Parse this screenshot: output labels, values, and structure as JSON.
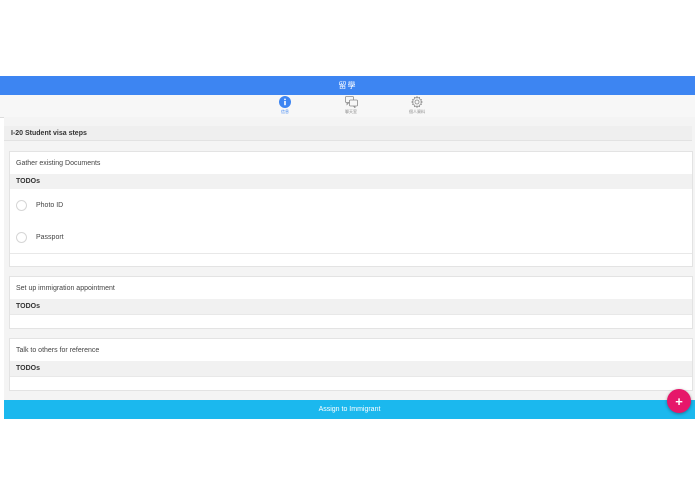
{
  "header": {
    "title": "留學"
  },
  "tabs": [
    {
      "label": "信息",
      "icon": "info-icon",
      "active": true
    },
    {
      "label": "聊天室",
      "icon": "chat-icon",
      "active": false
    },
    {
      "label": "個人資料",
      "icon": "gear-icon",
      "active": false
    }
  ],
  "section": {
    "title": "I-20 Student visa steps"
  },
  "steps": [
    {
      "title": "Gather existing Documents",
      "todos_label": "TODOs",
      "todos": [
        {
          "label": "Photo ID",
          "checked": false
        },
        {
          "label": "Passport",
          "checked": false
        }
      ]
    },
    {
      "title": "Set up immigration appointment",
      "todos_label": "TODOs",
      "todos": []
    },
    {
      "title": "Talk to others for reference",
      "todos_label": "TODOs",
      "todos": []
    }
  ],
  "actions": {
    "assign_label": "Assign to Immigrant",
    "fab_label": "+"
  },
  "colors": {
    "header": "#3d85f2",
    "assign_button": "#1bb8ee",
    "fab": "#e6176a"
  }
}
